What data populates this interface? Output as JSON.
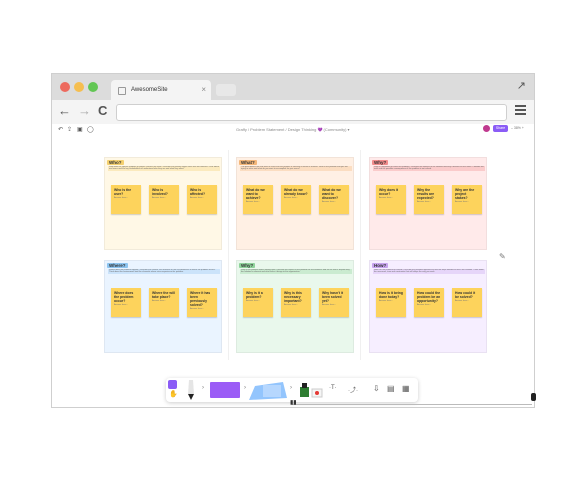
{
  "browser": {
    "tab_title": "AwesomeSite",
    "tab_close": "×",
    "expand_icon": "↗",
    "back": "←",
    "forward": "→",
    "reload": "C",
    "address": ""
  },
  "app": {
    "breadcrumb": "Graffy / Problem Statement / Design Thinking 💜 (Community) ▾",
    "share_label": "Share",
    "zoom": "– 38% +"
  },
  "sections": [
    {
      "label": "Who?",
      "label_color": "#f4d06f",
      "bg": "#fff8e6",
      "desc": "Who does the specific problem or project concern the most? Describe the primary target users that are affected. Think about end users and the key stakeholders to understand who they are and what they need.",
      "notes": [
        {
          "q": "Who is the user?",
          "a": "Answer here..."
        },
        {
          "q": "Who is involved?",
          "a": "Answer here..."
        },
        {
          "q": "Who is affected?",
          "a": "Answer here..."
        }
      ]
    },
    {
      "label": "What?",
      "label_color": "#f4b77a",
      "bg": "#fff0e4",
      "desc": "The goal defines the end state or result that the product or solution is meant to achieve. What is the problem that you are trying to solve and what do you want to accomplish for your users?",
      "notes": [
        {
          "q": "What do we want to achieve?",
          "a": "Answer here..."
        },
        {
          "q": "What do we already know?",
          "a": "Answer here..."
        },
        {
          "q": "What do we want to discover?",
          "a": "Answer here..."
        }
      ]
    },
    {
      "label": "Why?",
      "label_color": "#f08c8c",
      "bg": "#ffeaea",
      "desc": "Why is it important to solve this problem? Describe the benefits of the solution and why it matters for the users. Consider the risks and the possible consequences if the problem is not solved.",
      "notes": [
        {
          "q": "Why does it occur?",
          "a": "Answer here..."
        },
        {
          "q": "Why the results are expected?",
          "a": "Answer here..."
        },
        {
          "q": "Why are the project stakes?",
          "a": "Answer here..."
        }
      ]
    },
    {
      "label": "Where?",
      "label_color": "#8cc4f0",
      "bg": "#eaf4ff",
      "desc": "Where does the problem happen? Describe the context, the locations or the circumstances in which the problem occurs. Think about the environment and the channels where users experience the problem.",
      "notes": [
        {
          "q": "Where does the problem occur?",
          "a": "Answer here..."
        },
        {
          "q": "Where the will take place?",
          "a": "Answer here..."
        },
        {
          "q": "Where it has been previously solved?",
          "a": "Answer here..."
        }
      ]
    },
    {
      "label": "Why?",
      "label_color": "#8ed39a",
      "bg": "#e9f8ec",
      "desc": "Why is this problem worth solving now? Describe the impact of the problem for the business and for the users. Explain why the solution is relevant and what value it brings to the organization.",
      "notes": [
        {
          "q": "Why is it a problem?",
          "a": "Answer here..."
        },
        {
          "q": "Why is this necessary important?",
          "a": "Answer here..."
        },
        {
          "q": "Why hasn't it been solved yet?",
          "a": "Answer here..."
        }
      ]
    },
    {
      "label": "How?",
      "label_color": "#c7a4ee",
      "bg": "#f6eeff",
      "desc": "How can the problem be solved? Describe the possible approaches and the steps needed to reach the solution. Think about the resources, time and constraints that will shape the way you work.",
      "notes": [
        {
          "q": "How is it being done today?",
          "a": "Answer here..."
        },
        {
          "q": "How could the problem be an opportunity?",
          "a": "Answer here..."
        },
        {
          "q": "How could it be solved?",
          "a": "Answer here..."
        }
      ]
    }
  ],
  "toolbar": {
    "text_tool": "·T·",
    "connector_tool": "·⤴·"
  }
}
